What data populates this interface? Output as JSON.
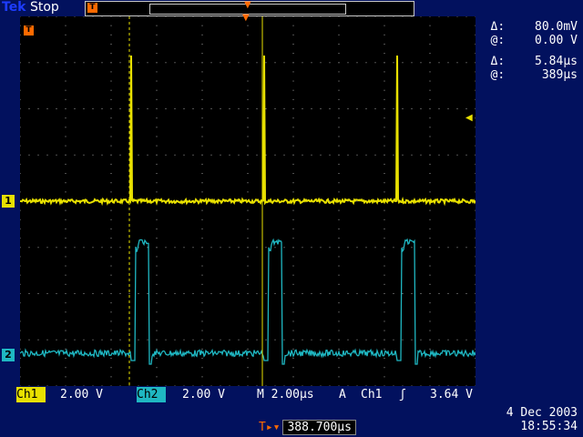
{
  "header": {
    "brand": "Tek",
    "run_state": "Stop"
  },
  "markers": {
    "trigger_letter": "T"
  },
  "readouts": {
    "delta_v_label": "Δ:",
    "delta_v_value": "80.0mV",
    "at_v_label": "@:",
    "at_v_value": "0.00 V",
    "delta_t_label": "Δ:",
    "delta_t_value": "5.84µs",
    "at_t_label": "@:",
    "at_t_value": "389µs"
  },
  "channels": {
    "ch1_marker": "1",
    "ch2_marker": "2"
  },
  "status": {
    "ch1_label": "Ch1",
    "ch1_scale": "2.00 V",
    "ch2_label": "Ch2",
    "ch2_scale": "2.00 V",
    "timebase": "M 2.00µs",
    "trigger_mode": "A",
    "trigger_source": "Ch1",
    "trigger_slope": "ʃ",
    "trigger_level": "3.64 V"
  },
  "trigger_position": {
    "label": "T▸▾",
    "value": "388.700µs"
  },
  "timestamp": {
    "date": "4 Dec 2003",
    "time": "18:55:34"
  },
  "colors": {
    "ch1": "#e8e000",
    "ch2": "#1fb7c2",
    "trigger": "#ff6a00",
    "grid": "#a0a0a0",
    "background": "#02115e"
  }
}
